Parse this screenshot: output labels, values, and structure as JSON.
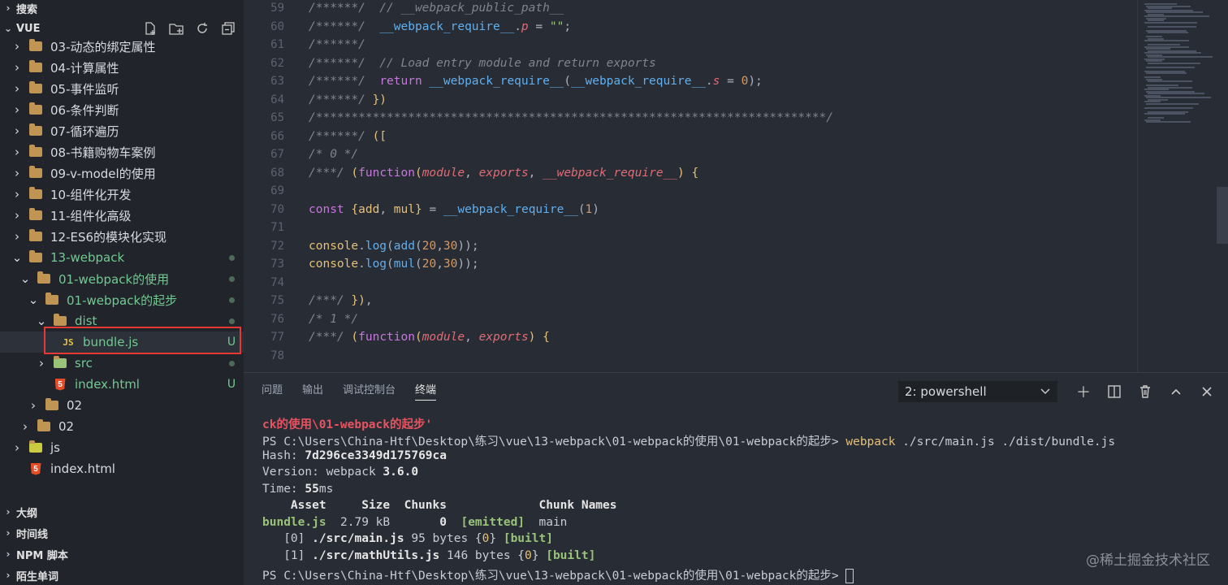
{
  "sidebar": {
    "search_label": "搜索",
    "explorer_title": "VUE",
    "folders": [
      "03-动态的绑定属性",
      "04-计算属性",
      "05-事件监听",
      "06-条件判断",
      "07-循环遍历",
      "08-书籍购物车案例",
      "09-v-model的使用",
      "10-组件化开发",
      "11-组件化高级",
      "12-ES6的模块化实现"
    ],
    "webpack_folder": "13-webpack",
    "webpack_use": "01-webpack的使用",
    "webpack_start": "01-webpack的起步",
    "dist": "dist",
    "bundle": "bundle.js",
    "bundle_status": "U",
    "src": "src",
    "index_inner": "index.html",
    "index_inner_status": "U",
    "folder_02a": "02",
    "folder_02b": "02",
    "js": "js",
    "index_root": "index.html",
    "bottom_sections": [
      "大纲",
      "时间线",
      "NPM 脚本",
      "陌生单词"
    ]
  },
  "editor": {
    "line_numbers": [
      "59",
      "60",
      "61",
      "62",
      "63",
      "64",
      "65",
      "66",
      "67",
      "68",
      "69",
      "70",
      "71",
      "72",
      "73",
      "74",
      "75",
      "76",
      "77",
      "78"
    ],
    "lines": [
      [
        [
          "cm",
          "/******/  // __webpack_public_path__"
        ]
      ],
      [
        [
          "cm",
          "/******/  "
        ],
        [
          "fn",
          "__webpack_require__"
        ],
        [
          "pl",
          "."
        ],
        [
          "pr",
          "p"
        ],
        [
          "pl",
          " = "
        ],
        [
          "st",
          "\"\""
        ],
        [
          "pl",
          ";"
        ]
      ],
      [
        [
          "cm",
          "/******/"
        ]
      ],
      [
        [
          "cm",
          "/******/  // Load entry module and return exports"
        ]
      ],
      [
        [
          "cm",
          "/******/  "
        ],
        [
          "kw",
          "return "
        ],
        [
          "fn",
          "__webpack_require__"
        ],
        [
          "pl",
          "("
        ],
        [
          "fn",
          "__webpack_require__"
        ],
        [
          "pl",
          "."
        ],
        [
          "pr",
          "s"
        ],
        [
          "pl",
          " = "
        ],
        [
          "nm",
          "0"
        ],
        [
          "pl",
          ");"
        ]
      ],
      [
        [
          "cm",
          "/******/ "
        ],
        [
          "ye",
          "})"
        ]
      ],
      [
        [
          "cm",
          "/************************************************************************/"
        ]
      ],
      [
        [
          "cm",
          "/******/ "
        ],
        [
          "br",
          "(["
        ]
      ],
      [
        [
          "cm",
          "/* 0 */"
        ]
      ],
      [
        [
          "cm",
          "/***/ "
        ],
        [
          "br",
          "("
        ],
        [
          "kw",
          "function"
        ],
        [
          "br",
          "("
        ],
        [
          "pr",
          "module"
        ],
        [
          "pl",
          ", "
        ],
        [
          "pr",
          "exports"
        ],
        [
          "pl",
          ", "
        ],
        [
          "pr",
          "__webpack_require__"
        ],
        [
          "br",
          ")"
        ],
        [
          "pl",
          " "
        ],
        [
          "br",
          "{"
        ]
      ],
      [],
      [
        [
          "kw",
          "const "
        ],
        [
          "br",
          "{"
        ],
        [
          "vr",
          "add"
        ],
        [
          "pl",
          ", "
        ],
        [
          "vr",
          "mul"
        ],
        [
          "br",
          "}"
        ],
        [
          "pl",
          " = "
        ],
        [
          "fn",
          "__webpack_require__"
        ],
        [
          "pl",
          "("
        ],
        [
          "nm",
          "1"
        ],
        [
          "pl",
          ")"
        ]
      ],
      [],
      [
        [
          "vr",
          "console"
        ],
        [
          "pl",
          "."
        ],
        [
          "fn",
          "log"
        ],
        [
          "pl",
          "("
        ],
        [
          "fn",
          "add"
        ],
        [
          "pl",
          "("
        ],
        [
          "nm",
          "20"
        ],
        [
          "pl",
          ","
        ],
        [
          "nm",
          "30"
        ],
        [
          "pl",
          "));"
        ]
      ],
      [
        [
          "vr",
          "console"
        ],
        [
          "pl",
          "."
        ],
        [
          "fn",
          "log"
        ],
        [
          "pl",
          "("
        ],
        [
          "fn",
          "mul"
        ],
        [
          "pl",
          "("
        ],
        [
          "nm",
          "20"
        ],
        [
          "pl",
          ","
        ],
        [
          "nm",
          "30"
        ],
        [
          "pl",
          "));"
        ]
      ],
      [],
      [
        [
          "cm",
          "/***/ "
        ],
        [
          "br",
          "})"
        ],
        [
          "pl",
          ","
        ]
      ],
      [
        [
          "cm",
          "/* 1 */"
        ]
      ],
      [
        [
          "cm",
          "/***/ "
        ],
        [
          "br",
          "("
        ],
        [
          "kw",
          "function"
        ],
        [
          "br",
          "("
        ],
        [
          "pr",
          "module"
        ],
        [
          "pl",
          ", "
        ],
        [
          "pr",
          "exports"
        ],
        [
          "br",
          ")"
        ],
        [
          "pl",
          " "
        ],
        [
          "br",
          "{"
        ]
      ],
      []
    ]
  },
  "panel": {
    "tabs": [
      "问题",
      "输出",
      "调试控制台",
      "终端"
    ],
    "terminal_select": "2: powershell",
    "terminal": {
      "line1": "ck的使用\\01-webpack的起步'",
      "prompt": "PS C:\\Users\\China-Htf\\Desktop\\练习\\vue\\13-webpack\\01-webpack的使用\\01-webpack的起步> ",
      "cmd": "webpack",
      "cmd_args": " ./src/main.js ./dist/bundle.js",
      "hash_label": "Hash: ",
      "hash": "7d296ce3349d175769ca",
      "version_label": "Version: webpack ",
      "version": "3.6.0",
      "time_label": "Time: ",
      "time": "55",
      "time_unit": "ms",
      "table_header": "    Asset     Size  Chunks             Chunk Names",
      "asset": "bundle.js",
      "asset_size": "  2.79 kB       ",
      "asset_chunk": "0",
      "asset_emitted": "  [emitted]",
      "asset_name": "  main",
      "mod0_idx": "   [0] ",
      "mod0_path": "./src/main.js",
      "mod0_size": " 95 bytes {",
      "mod0_chunk": "0",
      "mod0_close": "} ",
      "built": "[built]",
      "mod1_idx": "   [1] ",
      "mod1_path": "./src/mathUtils.js",
      "mod1_size": " 146 bytes {",
      "mod1_chunk": "0",
      "mod1_close": "} "
    }
  },
  "watermark": "@稀土掘金技术社区"
}
